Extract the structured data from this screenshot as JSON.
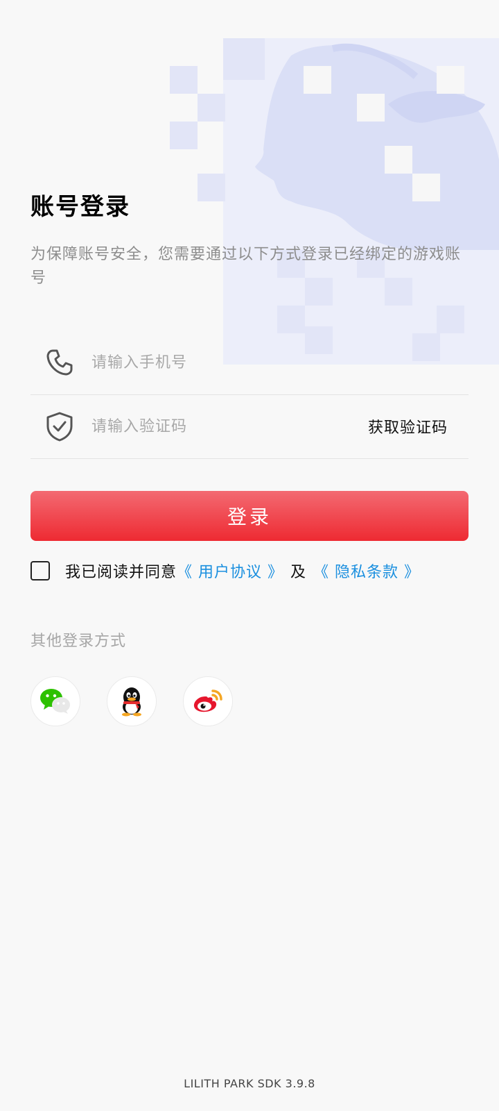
{
  "header": {
    "title": "账号登录",
    "subtitle": "为保障账号安全，您需要通过以下方式登录已经绑定的游戏账号"
  },
  "form": {
    "phone_placeholder": "请输入手机号",
    "code_placeholder": "请输入验证码",
    "get_code_label": "获取验证码",
    "login_label": "登录"
  },
  "agreement": {
    "prefix": "我已阅读并同意",
    "user_agreement": "《 用户协议 》",
    "and": "及",
    "privacy_policy": "《 隐私条款 》",
    "checked": false
  },
  "other_login": {
    "label": "其他登录方式",
    "methods": [
      "wechat-icon",
      "qq-icon",
      "weibo-icon"
    ]
  },
  "footer": {
    "version": "LILITH PARK SDK 3.9.8"
  },
  "colors": {
    "accent": "#ee2a32",
    "link": "#1a8fdf"
  }
}
